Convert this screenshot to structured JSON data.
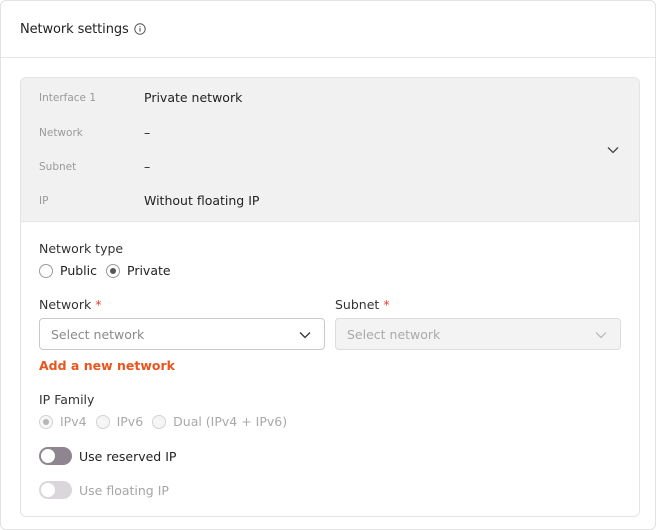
{
  "header": {
    "title": "Network settings",
    "info_icon": "info-circle-icon"
  },
  "summary": {
    "rows": [
      {
        "label": "Interface 1",
        "value": "Private network"
      },
      {
        "label": "Network",
        "value": "–"
      },
      {
        "label": "Subnet",
        "value": "–"
      },
      {
        "label": "IP",
        "value": "Without floating IP"
      }
    ],
    "expand_icon": "chevron-down-icon"
  },
  "form": {
    "network_type": {
      "label": "Network type",
      "options": [
        {
          "label": "Public",
          "checked": false
        },
        {
          "label": "Private",
          "checked": true
        }
      ]
    },
    "network": {
      "label": "Network",
      "required_mark": "*",
      "placeholder": "Select network"
    },
    "subnet": {
      "label": "Subnet",
      "required_mark": "*",
      "placeholder": "Select network",
      "disabled": true
    },
    "add_network_link": "Add a new network",
    "ip_family": {
      "label": "IP Family",
      "options": [
        {
          "label": "IPv4",
          "checked": true
        },
        {
          "label": "IPv6",
          "checked": false
        },
        {
          "label": "Dual (IPv4 + IPv6)",
          "checked": false
        }
      ],
      "disabled": true
    },
    "reserved_ip": {
      "label": "Use reserved IP",
      "on": false
    },
    "floating_ip": {
      "label": "Use floating IP",
      "on": false,
      "disabled": true
    }
  },
  "colors": {
    "accent": "#e8551d",
    "required": "#e5402a",
    "summary_bg": "#f1f1f1",
    "toggle_off": "#8e8590"
  }
}
